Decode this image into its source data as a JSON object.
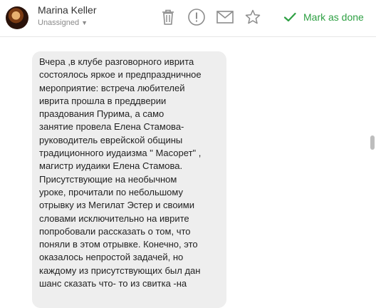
{
  "header": {
    "contact_name": "Marina Keller",
    "assignment": "Unassigned",
    "actions": {
      "delete": "trash-icon",
      "spam": "alert-icon",
      "email": "envelope-icon",
      "star": "star-icon"
    },
    "mark_done_label": "Mark as done"
  },
  "colors": {
    "accent_green": "#2ea043",
    "bubble_bg": "#eeeeee",
    "icon_gray": "#8c8c8c"
  },
  "message": {
    "text": "Вчера ,в клубе разговорного иврита\nсостоялось яркое и предпраздничное\nмероприятие: встреча любителей\nиврита прошла в преддверии\nпраздования Пурима, а само\nзанятие провела Елена Стамова-\nруководитель еврейской общины\nтрадиционного иудаизма \" Масорет\" ,\nмагистр иудаики Елена Стамова.\nПрисутствующие на необычном\nуроке, прочитали по небольшому\nотрывку из Мегилат Эстер и своими\nсловами исключительно на иврите\nпопробовали рассказать о том, что\nпоняли в этом отрывке. Конечно, это\nоказалось непростой задачей, но\nкаждому из присутствующих был дан\nшанс сказать что- то из свитка -на"
  }
}
